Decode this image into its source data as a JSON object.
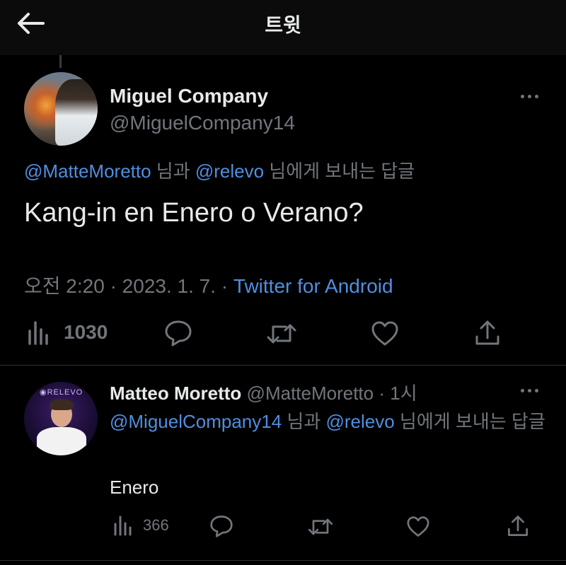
{
  "header": {
    "title": "트윗"
  },
  "tweet": {
    "author_name": "Miguel Company",
    "author_handle": "@MiguelCompany14",
    "reply_mention_1": "@MatteMoretto",
    "reply_mid": " 님과 ",
    "reply_mention_2": "@relevo",
    "reply_suffix": " 님에게 보내는 답글",
    "text": "Kang-in en Enero o Verano?",
    "time": "오전 2:20 · 2023. 1. 7. · ",
    "source": "Twitter for Android",
    "views": "1030"
  },
  "reply": {
    "author_name": "Matteo Moretto",
    "author_handle": " @MatteMoretto",
    "time": " · 1시",
    "reply_mention_1": "@MiguelCompany14",
    "reply_mid": " 님과 ",
    "reply_mention_2": "@relevo",
    "reply_suffix": " 님에게 보내는 답글",
    "text": "Enero",
    "views": "366",
    "avatar_brand": "◉RELEVO"
  },
  "icons": {
    "back": "arrow-left-icon",
    "more": "more-horizontal-icon",
    "views": "analytics-icon",
    "reply": "reply-bubble-icon",
    "retweet": "retweet-icon",
    "like": "heart-icon",
    "share": "share-icon"
  },
  "colors": {
    "background": "#000000",
    "link": "#4f8fe0",
    "muted": "#71767b",
    "text": "#e7e9ea"
  }
}
